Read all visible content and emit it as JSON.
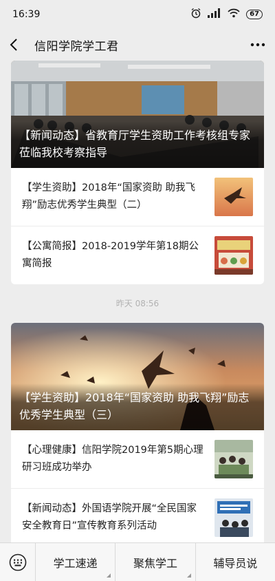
{
  "status": {
    "time": "16:39",
    "battery": "67"
  },
  "nav": {
    "title": "信阳学院学工君"
  },
  "group1": {
    "hero_title": "【新闻动态】省教育厅学生资助工作考核组专家莅临我校考察指导",
    "items": [
      {
        "title": "【学生资助】2018年“国家资助  助我飞翔”励志优秀学生典型（二）"
      },
      {
        "title": "【公寓简报】2018-2019学年第18期公寓简报"
      }
    ]
  },
  "timestamp": "昨天 08:56",
  "group2": {
    "hero_title": "【学生资助】2018年“国家资助  助我飞翔”励志优秀学生典型（三）",
    "items": [
      {
        "title": "【心理健康】信阳学院2019年第5期心理研习班成功举办"
      },
      {
        "title": "【新闻动态】外国语学院开展“全民国家安全教育日”宣传教育系列活动"
      }
    ]
  },
  "menu": {
    "items": [
      {
        "label": "学工速递"
      },
      {
        "label": "聚焦学工"
      },
      {
        "label": "辅导员说"
      }
    ]
  },
  "colors": {
    "background": "#ededed",
    "card": "#ffffff",
    "timestamp": "#b2b2b2"
  },
  "icons": [
    "alarm-icon",
    "signal-icon",
    "wifi-icon",
    "battery-icon",
    "back-icon",
    "more-icon",
    "keyboard-icon"
  ]
}
